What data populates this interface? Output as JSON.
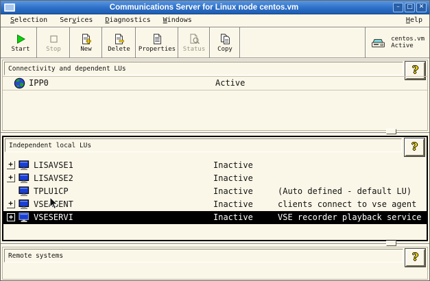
{
  "titlebar": {
    "title": "Communications Server for Linux node centos.vm",
    "controls": {
      "minimize": "–",
      "maximize": "□",
      "close": "✕"
    }
  },
  "menubar": {
    "items": [
      {
        "pre": "",
        "key": "S",
        "post": "election"
      },
      {
        "pre": "Ser",
        "key": "v",
        "post": "ices"
      },
      {
        "pre": "",
        "key": "D",
        "post": "iagnostics"
      },
      {
        "pre": "",
        "key": "W",
        "post": "indows"
      }
    ],
    "help": {
      "pre": "",
      "key": "H",
      "post": "elp"
    }
  },
  "toolbar": {
    "buttons": {
      "start": "Start",
      "stop": "Stop",
      "new": "New",
      "delete": "Delete",
      "properties": "Properties",
      "status": "Status",
      "copy": "Copy"
    },
    "node": {
      "name": "centos.vm",
      "status": "Active"
    }
  },
  "panes": {
    "connectivity": {
      "title": "Connectivity and dependent LUs",
      "help_label": "?",
      "rows": [
        {
          "icon": "globe-icon",
          "name": "IPP0",
          "status": "Active"
        }
      ]
    },
    "independent": {
      "title": "Independent local LUs",
      "help_label": "?",
      "rows": [
        {
          "icon": "monitor-icon",
          "expandable": true,
          "name": "LISAVSE1",
          "status": "Inactive",
          "comment": ""
        },
        {
          "icon": "monitor-icon",
          "expandable": true,
          "name": "LISAVSE2",
          "status": "Inactive",
          "comment": ""
        },
        {
          "icon": "monitor-icon",
          "expandable": false,
          "name": "TPLU1CP",
          "status": "Inactive",
          "comment": "(Auto defined - default LU)"
        },
        {
          "icon": "monitor-icon",
          "expandable": true,
          "name": "VSEAGENT",
          "status": "Inactive",
          "comment": "clients connect to vse agent"
        },
        {
          "icon": "monitor-icon",
          "expandable": true,
          "name": "VSESERVI",
          "status": "Inactive",
          "comment": "VSE recorder playback service",
          "selected": true
        }
      ]
    },
    "remote": {
      "title": "Remote systems",
      "help_label": "?"
    }
  },
  "icons": {
    "expander_plus": "+"
  },
  "colors": {
    "titlebar_blue": "#2f74cf",
    "background_cream": "#fbf7e8",
    "selection_bg": "#000000",
    "selection_fg": "#ffffff",
    "help_yellow": "#f7dc00",
    "start_green": "#0bd20b",
    "lu_icon_blue": "#1a3fd4"
  }
}
